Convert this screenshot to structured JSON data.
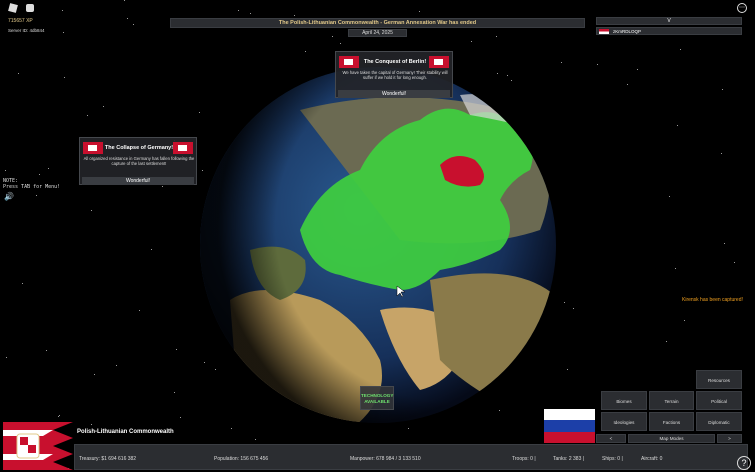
{
  "hud": {
    "xp": "715657 XP",
    "server_id": "Server ID: 4db844",
    "menu_icon": "menu-icon",
    "note_line1": "NOTE:",
    "note_line2": "Press TAB for Menu!"
  },
  "banner": {
    "headline": "The Polish-Lithuanian Commonwealth - German Annexation War has ended",
    "date": "April 24, 2025"
  },
  "leaderboard": {
    "header": "V",
    "player": "zKmRDLOQP"
  },
  "events": [
    {
      "title": "The Conquest of Berlin!",
      "body": "We have taken the capital of Germany! Their stability will suffer if we hold it for long enough.",
      "button": "Wonderful!"
    },
    {
      "title": "The Collapse of Germany!",
      "body": "All organized resistance in Germany has fallen following the capture of the last settlement!",
      "button": "Wonderful!"
    }
  ],
  "notifications": {
    "captured": "Kirensk has been captured!"
  },
  "tech": {
    "line1": "TECHNOLOGY",
    "line2": "AVAILABLE"
  },
  "map_modes": {
    "resources": "Resources",
    "biomes": "Biomes",
    "terrain": "Terrain",
    "political": "Political",
    "ideologies": "Ideologies",
    "factions": "Factions",
    "diplomatic": "Diplomatic",
    "prev": "<",
    "label": "Map Modes",
    "next": ">"
  },
  "nation": {
    "name": "Polish-Lithuanian Commonwealth",
    "treasury": "Treasury:   $1 694 616 382",
    "population": "Population: 156 675 456",
    "manpower": "Manpower:  678 984  /  3 133 510",
    "troops": "Troops: 0  |",
    "tanks": "Tanks: 2 383  |",
    "ships": "Ships: 0  |",
    "aircraft": "Aircraft: 0"
  },
  "colors": {
    "accent_gold": "#e2c98a",
    "territory_green": "#3fcf3f",
    "enemy_red": "#c8102e",
    "panel": "#2b2d31"
  }
}
